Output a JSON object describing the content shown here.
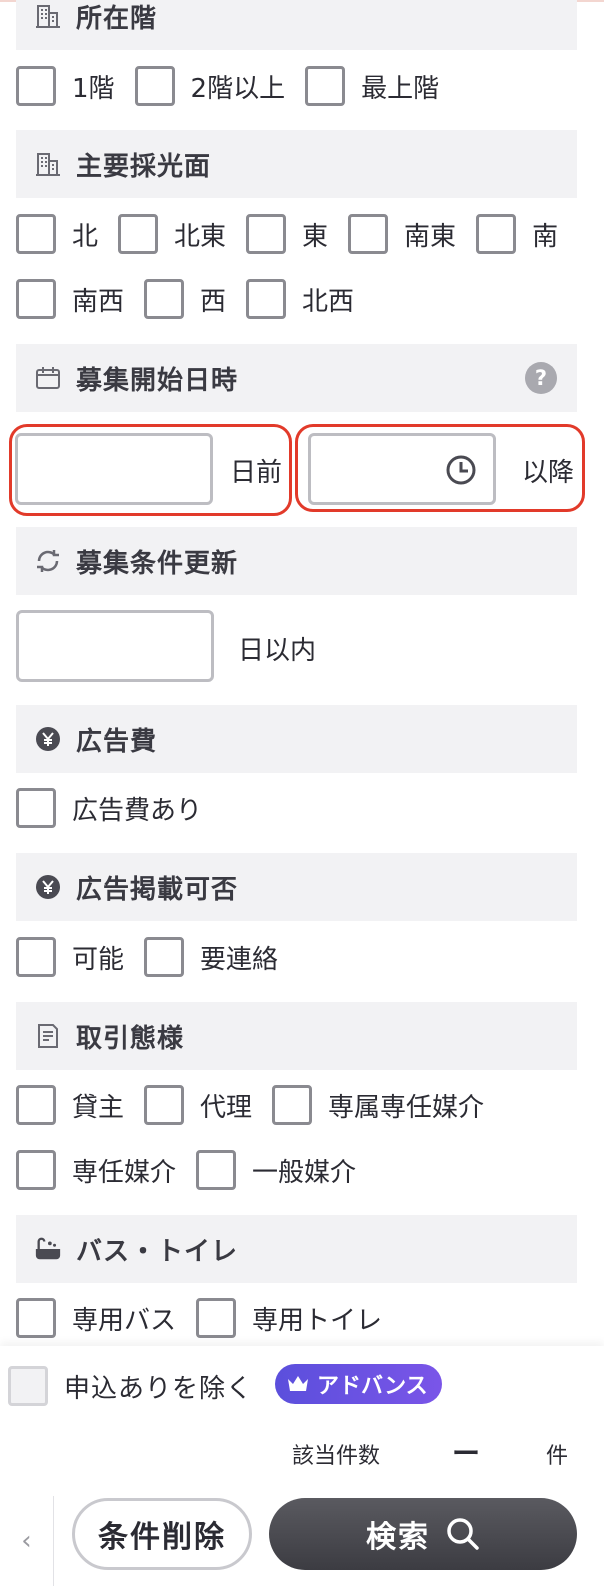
{
  "sections": {
    "floor": {
      "title": "所在階",
      "options": [
        "1階",
        "2階以上",
        "最上階"
      ]
    },
    "light": {
      "title": "主要採光面",
      "options_row1": [
        "北",
        "北東",
        "東",
        "南東",
        "南"
      ],
      "options_row2": [
        "南西",
        "西",
        "北西"
      ]
    },
    "recruit_start": {
      "title": "募集開始日時",
      "help": "?",
      "days_suffix": "日前",
      "after_suffix": "以降"
    },
    "recruit_update": {
      "title": "募集条件更新",
      "within_suffix": "日以内"
    },
    "ad_fee": {
      "title": "広告費",
      "option": "広告費あり"
    },
    "ad_publish": {
      "title": "広告掲載可否",
      "options": [
        "可能",
        "要連絡"
      ]
    },
    "transaction": {
      "title": "取引態様",
      "options_row1": [
        "貸主",
        "代理",
        "専属専任媒介"
      ],
      "options_row2": [
        "専任媒介",
        "一般媒介"
      ]
    },
    "bath_toilet": {
      "title": "バス・トイレ",
      "options": [
        "専用バス",
        "専用トイレ"
      ]
    }
  },
  "footer": {
    "exclude_label": "申込ありを除く",
    "advance_badge": "アドバンス",
    "count_label": "該当件数",
    "count_value": "ー",
    "count_unit": "件",
    "back": "‹",
    "clear_label": "条件削除",
    "search_label": "検索"
  },
  "colors": {
    "highlight": "#e23a2a",
    "badge": "#6a52e2",
    "search_button": "#4a4a50"
  }
}
